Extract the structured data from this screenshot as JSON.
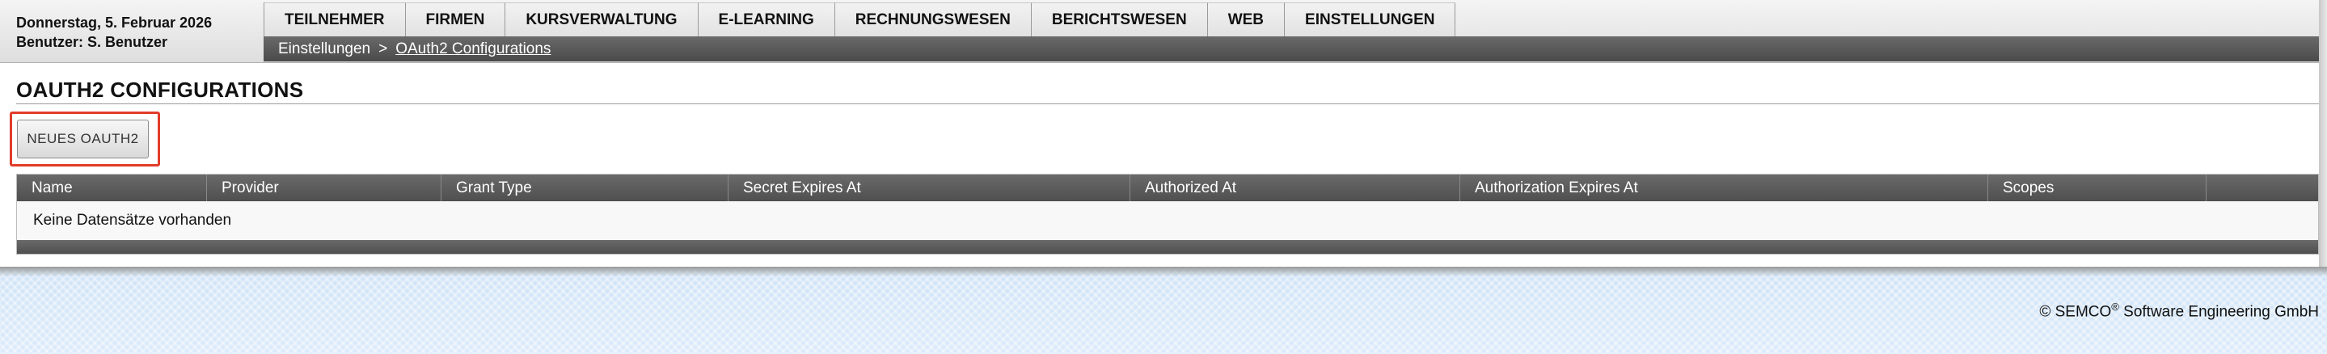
{
  "header": {
    "date": "Donnerstag, 5. Februar 2026",
    "user": "Benutzer: S. Benutzer"
  },
  "nav": {
    "items": [
      {
        "label": "TEILNEHMER"
      },
      {
        "label": "FIRMEN"
      },
      {
        "label": "KURSVERWALTUNG"
      },
      {
        "label": "E-LEARNING"
      },
      {
        "label": "RECHNUNGSWESEN"
      },
      {
        "label": "BERICHTSWESEN"
      },
      {
        "label": "WEB"
      },
      {
        "label": "EINSTELLUNGEN"
      }
    ]
  },
  "breadcrumb": {
    "root": "Einstellungen",
    "separator": ">",
    "current": "OAuth2 Configurations"
  },
  "main": {
    "title": "OAUTH2 CONFIGURATIONS",
    "new_button": "NEUES OAUTH2",
    "table": {
      "columns": [
        {
          "label": "Name"
        },
        {
          "label": "Provider"
        },
        {
          "label": "Grant Type"
        },
        {
          "label": "Secret Expires At"
        },
        {
          "label": "Authorized At"
        },
        {
          "label": "Authorization Expires At"
        },
        {
          "label": "Scopes"
        },
        {
          "label": ""
        }
      ],
      "empty_message": "Keine Datensätze vorhanden"
    }
  },
  "footer": {
    "copyright_prefix": "© SEMCO",
    "copyright_mark": "®",
    "copyright_suffix": " Software Engineering GmbH"
  },
  "colors": {
    "highlight": "#e23b2a",
    "bar_dark": "#4f4f4f",
    "footer_blue": "#d5e7f8"
  }
}
